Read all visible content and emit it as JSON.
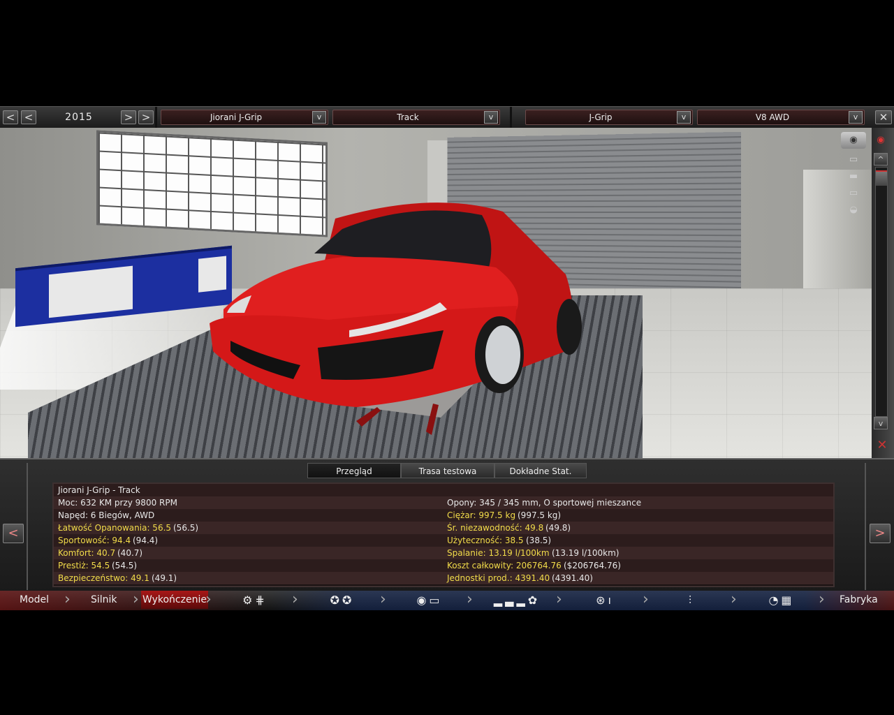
{
  "topbar": {
    "year": "2015",
    "prev_fast": "<",
    "prev": "<",
    "next": ">",
    "next_fast": ">",
    "model_select": "Jiorani J-Grip",
    "trim_select": "Track",
    "body_select": "J-Grip",
    "engine_select": "V8 AWD",
    "dropdown_glyph": "v",
    "close_glyph": "✕"
  },
  "sidebar": {
    "scroll_up": "^",
    "scroll_down": "v"
  },
  "tabs": [
    {
      "label": "Przegląd",
      "active": true
    },
    {
      "label": "Trasa testowa",
      "active": false
    },
    {
      "label": "Dokładne Stat.",
      "active": false
    }
  ],
  "stats": {
    "title": "Jiorani J-Grip - Track",
    "left": [
      {
        "label": "Moc: 632 KM przy 9800 RPM",
        "value": "",
        "highlight": false
      },
      {
        "label": "Napęd: 6 Biegów, AWD",
        "value": "",
        "highlight": false
      },
      {
        "label": "Łatwość Opanowania: 56.5",
        "value": "(56.5)",
        "highlight": true
      },
      {
        "label": "Sportowość: 94.4",
        "value": "(94.4)",
        "highlight": true
      },
      {
        "label": "Komfort: 40.7",
        "value": "(40.7)",
        "highlight": true
      },
      {
        "label": "Prestiż: 54.5",
        "value": "(54.5)",
        "highlight": true
      },
      {
        "label": "Bezpieczeństwo: 49.1",
        "value": "(49.1)",
        "highlight": true
      }
    ],
    "right": [
      {
        "label": "Opony: 345 / 345 mm, O sportowej mieszance",
        "value": "",
        "highlight": false
      },
      {
        "label": "Ciężar: 997.5 kg",
        "value": "(997.5 kg)",
        "highlight": true
      },
      {
        "label": "Śr. niezawodność: 49.8",
        "value": "(49.8)",
        "highlight": true
      },
      {
        "label": "Użyteczność: 38.5",
        "value": "(38.5)",
        "highlight": true
      },
      {
        "label": "Spalanie: 13.19 l/100km",
        "value": "(13.19 l/100km)",
        "highlight": true
      },
      {
        "label": "Koszt całkowity: 206764.76",
        "value": "($206764.76)",
        "highlight": true
      },
      {
        "label": "Jednostki prod.: 4391.40",
        "value": "(4391.40)",
        "highlight": true
      }
    ],
    "prev_arrow": "<",
    "next_arrow": ">"
  },
  "nav": {
    "model": "Model",
    "engine": "Silnik",
    "finish": "Wykończenie",
    "factory": "Fabryka"
  },
  "colors": {
    "highlight": "#f2dc4a",
    "car": "#d81a1a"
  }
}
